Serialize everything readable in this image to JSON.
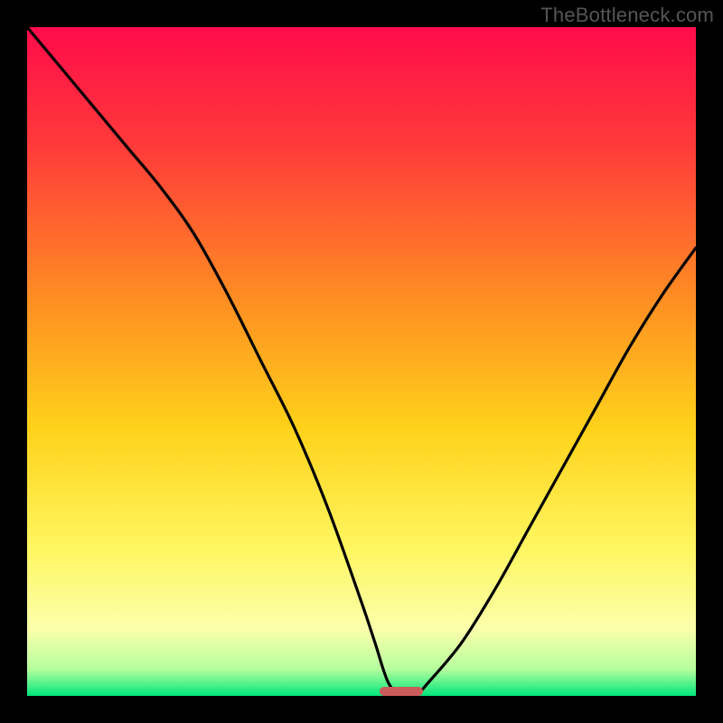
{
  "watermark": "TheBottleneck.com",
  "chart_data": {
    "type": "line",
    "title": "",
    "xlabel": "",
    "ylabel": "",
    "xlim": [
      0,
      100
    ],
    "ylim": [
      0,
      100
    ],
    "x": [
      0,
      5,
      10,
      15,
      20,
      25,
      30,
      35,
      40,
      45,
      50,
      52,
      54,
      56,
      58,
      60,
      65,
      70,
      75,
      80,
      85,
      90,
      95,
      100
    ],
    "values": [
      100,
      94,
      88,
      82,
      76,
      69,
      60,
      50,
      40,
      28,
      14,
      8,
      2,
      0,
      0,
      2,
      8,
      16,
      25,
      34,
      43,
      52,
      60,
      67
    ],
    "gradient_stops": [
      {
        "offset": 0.0,
        "color": "#ff0b4b"
      },
      {
        "offset": 0.18,
        "color": "#ff3b3a"
      },
      {
        "offset": 0.4,
        "color": "#ff8b23"
      },
      {
        "offset": 0.6,
        "color": "#ffd21a"
      },
      {
        "offset": 0.78,
        "color": "#fff661"
      },
      {
        "offset": 0.9,
        "color": "#fbffab"
      },
      {
        "offset": 0.96,
        "color": "#b6ff9e"
      },
      {
        "offset": 1.0,
        "color": "#00e67a"
      }
    ],
    "marker": {
      "x_center": 56,
      "y": 0,
      "width_frac": 0.065,
      "height_frac": 0.014,
      "color": "#cc5b5b"
    }
  }
}
